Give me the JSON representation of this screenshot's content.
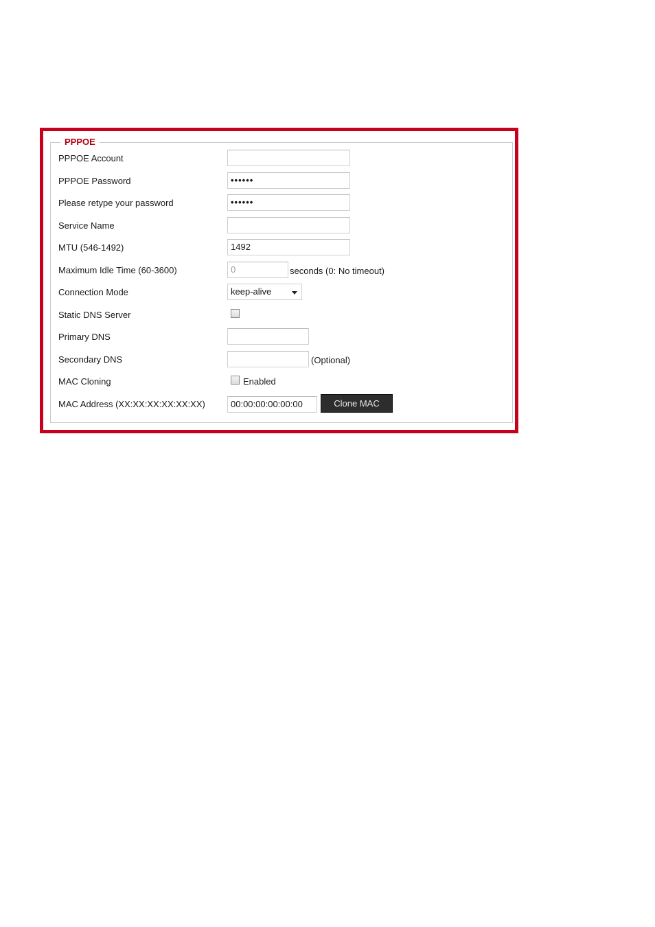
{
  "section": {
    "title": "PPPOE"
  },
  "fields": {
    "account": {
      "label": "PPPOE Account",
      "value": ""
    },
    "password": {
      "label": "PPPOE Password",
      "value": "••••••"
    },
    "retype_password": {
      "label": "Please retype your password",
      "value": "••••••"
    },
    "service_name": {
      "label": "Service Name",
      "value": ""
    },
    "mtu": {
      "label": "MTU (546-1492)",
      "value": "1492"
    },
    "idle_time": {
      "label": "Maximum Idle Time (60-3600)",
      "value": "0",
      "suffix": "seconds (0: No timeout)"
    },
    "connection_mode": {
      "label": "Connection Mode",
      "selected": "keep-alive"
    },
    "static_dns": {
      "label": "Static DNS Server",
      "checked": false
    },
    "primary_dns": {
      "label": "Primary DNS",
      "value": ""
    },
    "secondary_dns": {
      "label": "Secondary DNS",
      "value": "",
      "suffix": "(Optional)"
    },
    "mac_cloning": {
      "label": "MAC Cloning",
      "checked": false,
      "checkbox_label": "Enabled"
    },
    "mac_address": {
      "label": "MAC Address (XX:XX:XX:XX:XX:XX)",
      "value": "00:00:00:00:00:00",
      "button_label": "Clone MAC"
    }
  },
  "colors": {
    "frame_border": "#c8001e",
    "legend_text": "#b00010",
    "button_bg": "#2d2d2d"
  }
}
